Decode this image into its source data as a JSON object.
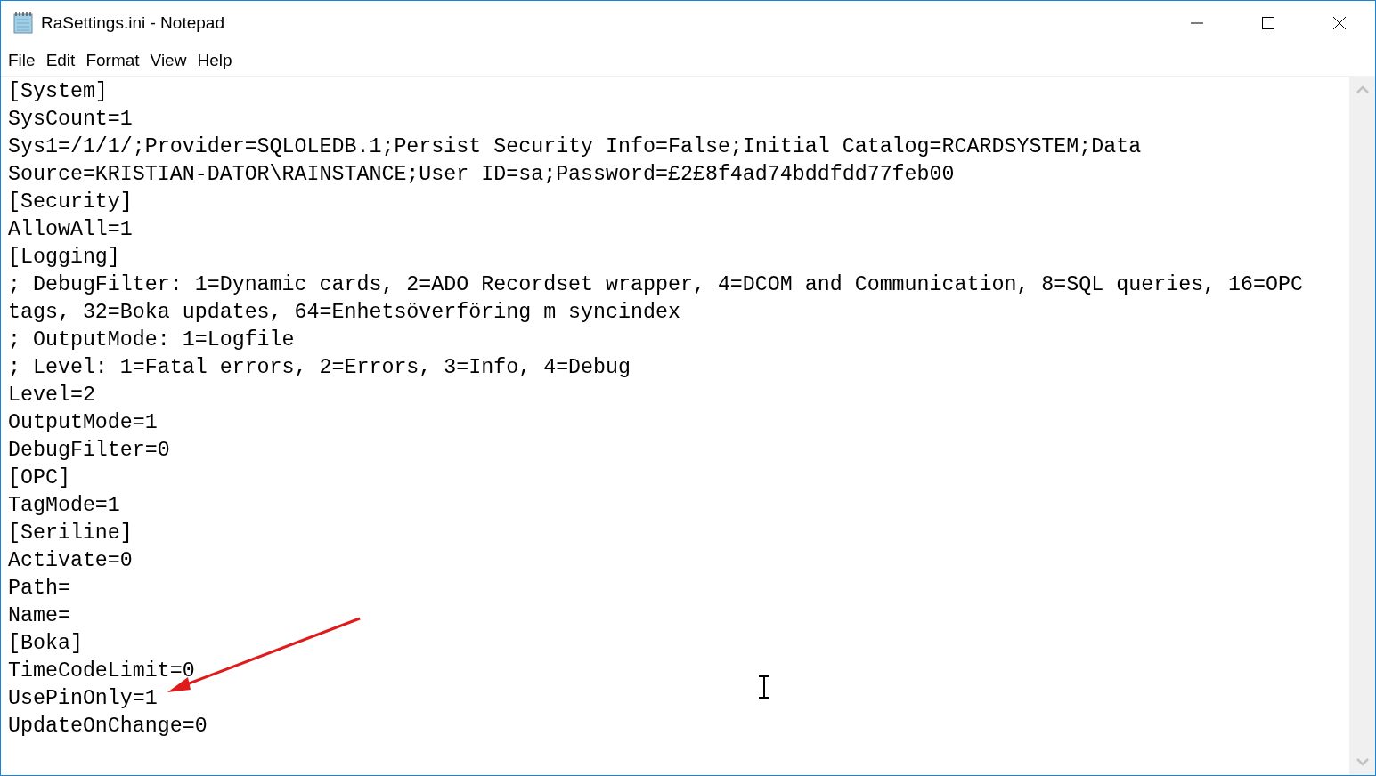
{
  "window": {
    "title": "RaSettings.ini - Notepad"
  },
  "menu": [
    "File",
    "Edit",
    "Format",
    "View",
    "Help"
  ],
  "lines": [
    "[System]",
    "SysCount=1",
    "Sys1=/1/1/;Provider=SQLOLEDB.1;Persist Security Info=False;Initial Catalog=RCARDSYSTEM;Data",
    "Source=KRISTIAN-DATOR\\RAINSTANCE;User ID=sa;Password=£2£8f4ad74bddfdd77feb00",
    "[Security]",
    "AllowAll=1",
    "[Logging]",
    "; DebugFilter: 1=Dynamic cards, 2=ADO Recordset wrapper, 4=DCOM and Communication, 8=SQL queries, 16=OPC",
    "tags, 32=Boka updates, 64=Enhetsöverföring m syncindex",
    "; OutputMode: 1=Logfile",
    "; Level: 1=Fatal errors, 2=Errors, 3=Info, 4=Debug",
    "Level=2",
    "OutputMode=1",
    "DebugFilter=0",
    "[OPC]",
    "TagMode=1",
    "[Seriline]",
    "Activate=0",
    "Path=",
    "Name=",
    "[Boka]",
    "TimeCodeLimit=0",
    "UsePinOnly=1",
    "UpdateOnChange=0"
  ]
}
